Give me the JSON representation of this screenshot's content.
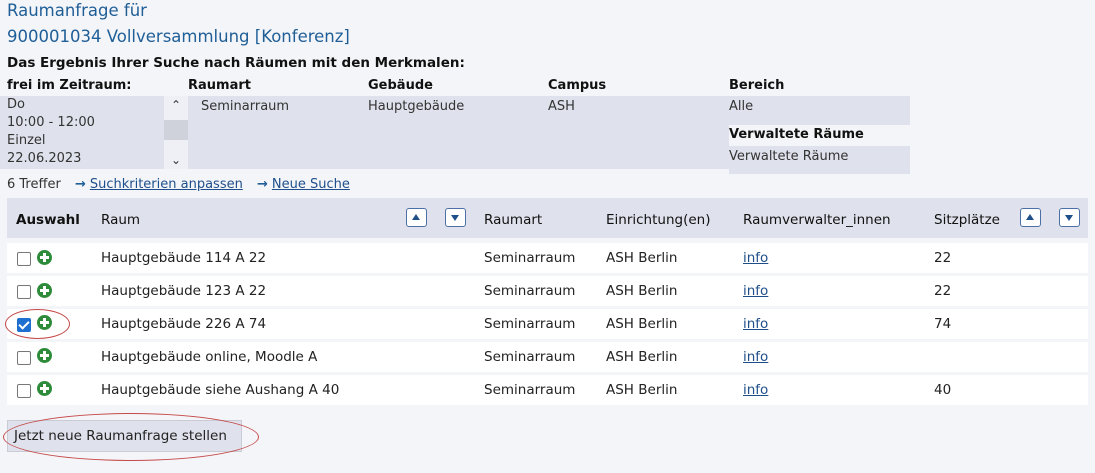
{
  "header": {
    "title_line1": "Raumanfrage für",
    "title_line2": "900001034 Vollversammlung [Konferenz]",
    "subheading": "Das Ergebnis Ihrer Suche nach Räumen mit den Merkmalen:"
  },
  "criteria": {
    "time_label": "frei im Zeitraum:",
    "time_lines": [
      "Do",
      "10:00 - 12:00",
      "Einzel",
      "22.06.2023"
    ],
    "raumart_label": "Raumart",
    "raumart_value": "Seminarraum",
    "gebaeude_label": "Gebäude",
    "gebaeude_value": "Hauptgebäude",
    "campus_label": "Campus",
    "campus_value": "ASH",
    "bereich_label": "Bereich",
    "bereich_value": "Alle",
    "verwaltete_label": "Verwaltete Räume",
    "verwaltete_value": "Verwaltete Räume"
  },
  "results": {
    "count": "6 Treffer",
    "adjust_link": "Suchkriterien anpassen",
    "new_search_link": "Neue Suche"
  },
  "table": {
    "headers": {
      "auswahl": "Auswahl",
      "raum": "Raum",
      "raumart": "Raumart",
      "einrichtung": "Einrichtung(en)",
      "verwalter": "Raumverwalter_innen",
      "sitzplaetze": "Sitzplätze"
    },
    "rows": [
      {
        "raum": "Hauptgebäude 114 A 22",
        "raumart": "Seminarraum",
        "einrichtung": "ASH Berlin",
        "verwalter": "info",
        "sitzplaetze": "22",
        "checked": false
      },
      {
        "raum": "Hauptgebäude 123 A 22",
        "raumart": "Seminarraum",
        "einrichtung": "ASH Berlin",
        "verwalter": "info",
        "sitzplaetze": "22",
        "checked": false
      },
      {
        "raum": "Hauptgebäude 226 A 74",
        "raumart": "Seminarraum",
        "einrichtung": "ASH Berlin",
        "verwalter": "info",
        "sitzplaetze": "74",
        "checked": true
      },
      {
        "raum": "Hauptgebäude online, Moodle A",
        "raumart": "Seminarraum",
        "einrichtung": "ASH Berlin",
        "verwalter": "info",
        "sitzplaetze": "",
        "checked": false
      },
      {
        "raum": "Hauptgebäude siehe Aushang A 40",
        "raumart": "Seminarraum",
        "einrichtung": "ASH Berlin",
        "verwalter": "info",
        "sitzplaetze": "40",
        "checked": false
      }
    ]
  },
  "actions": {
    "submit_label": "Jetzt neue Raumanfrage stellen"
  },
  "colors": {
    "title": "#1f5e97",
    "link": "#1f4f8a",
    "panel": "#dfe2ec",
    "add_icon": "#2e8b3a",
    "highlight": "#c64a4a"
  }
}
